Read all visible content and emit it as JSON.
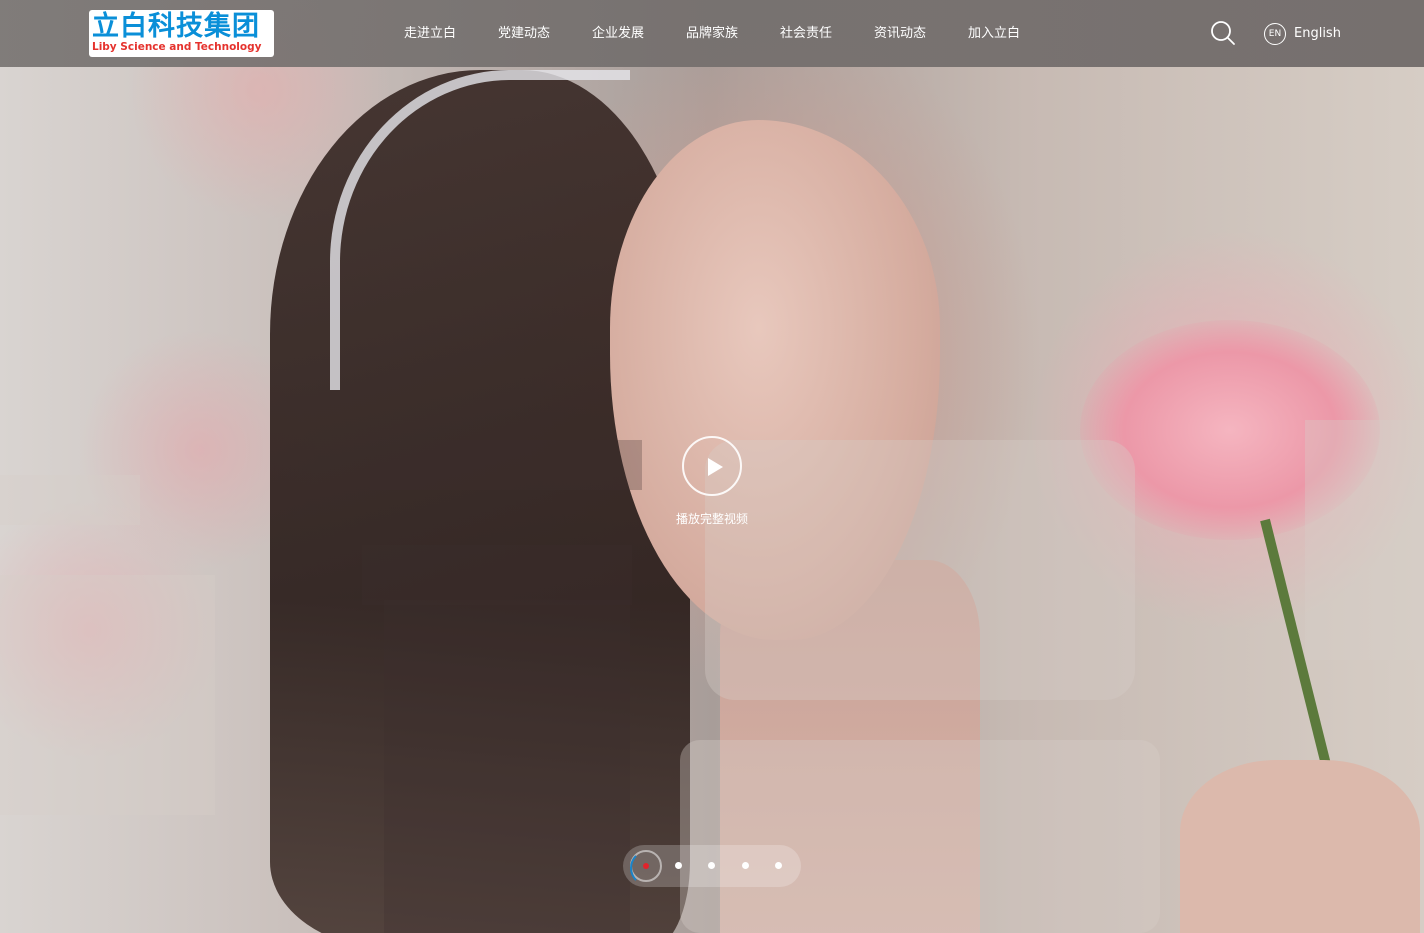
{
  "header": {
    "logo": {
      "cn": "立白科技集团",
      "en": "Liby Science and Technology"
    },
    "nav": [
      {
        "label": "走进立白"
      },
      {
        "label": "党建动态"
      },
      {
        "label": "企业发展"
      },
      {
        "label": "品牌家族"
      },
      {
        "label": "社会责任"
      },
      {
        "label": "资讯动态"
      },
      {
        "label": "加入立白"
      }
    ],
    "search_icon": "search-icon",
    "language": {
      "badge": "EN",
      "label": "English"
    }
  },
  "hero": {
    "play_icon": "play-icon",
    "play_label": "播放完整视频"
  },
  "colors": {
    "logo_blue": "#0a8fd8",
    "logo_red": "#e5322d",
    "pager_active": "#e2232b",
    "pager_ring": "#1a84c9"
  }
}
